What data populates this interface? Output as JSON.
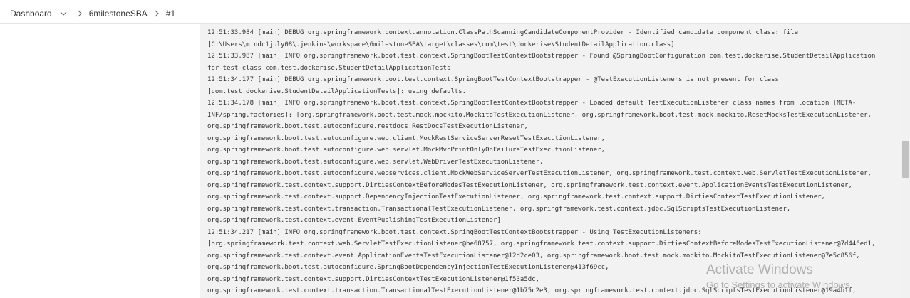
{
  "breadcrumb": {
    "dashboard": "Dashboard",
    "job": "6milestoneSBA",
    "build": "#1"
  },
  "icons": {
    "dropdown": "chevron-down-icon",
    "separator": "chevron-right-icon"
  },
  "console": {
    "lines": [
      "12:51:33.984 [main] DEBUG org.springframework.context.annotation.ClassPathScanningCandidateComponentProvider - Identified candidate component class: file",
      "[C:\\Users\\mindc1july08\\.jenkins\\workspace\\6milestoneSBA\\target\\classes\\com\\test\\dockerise\\StudentDetailApplication.class]",
      "12:51:33.987 [main] INFO org.springframework.boot.test.context.SpringBootTestContextBootstrapper - Found @SpringBootConfiguration com.test.dockerise.StudentDetailApplication",
      "for test class com.test.dockerise.StudentDetailApplicationTests",
      "12:51:34.177 [main] DEBUG org.springframework.boot.test.context.SpringBootTestContextBootstrapper - @TestExecutionListeners is not present for class",
      "[com.test.dockerise.StudentDetailApplicationTests]: using defaults.",
      "12:51:34.178 [main] INFO org.springframework.boot.test.context.SpringBootTestContextBootstrapper - Loaded default TestExecutionListener class names from location [META-",
      "INF/spring.factories]: [org.springframework.boot.test.mock.mockito.MockitoTestExecutionListener, org.springframework.boot.test.mock.mockito.ResetMocksTestExecutionListener,",
      "org.springframework.boot.test.autoconfigure.restdocs.RestDocsTestExecutionListener,",
      "org.springframework.boot.test.autoconfigure.web.client.MockRestServiceServerResetTestExecutionListener,",
      "org.springframework.boot.test.autoconfigure.web.servlet.MockMvcPrintOnlyOnFailureTestExecutionListener,",
      "org.springframework.boot.test.autoconfigure.web.servlet.WebDriverTestExecutionListener,",
      "org.springframework.boot.test.autoconfigure.webservices.client.MockWebServiceServerTestExecutionListener, org.springframework.test.context.web.ServletTestExecutionListener,",
      "org.springframework.test.context.support.DirtiesContextBeforeModesTestExecutionListener, org.springframework.test.context.event.ApplicationEventsTestExecutionListener,",
      "org.springframework.test.context.support.DependencyInjectionTestExecutionListener, org.springframework.test.context.support.DirtiesContextTestExecutionListener,",
      "org.springframework.test.context.transaction.TransactionalTestExecutionListener, org.springframework.test.context.jdbc.SqlScriptsTestExecutionListener,",
      "org.springframework.test.context.event.EventPublishingTestExecutionListener]",
      "12:51:34.217 [main] INFO org.springframework.boot.test.context.SpringBootTestContextBootstrapper - Using TestExecutionListeners:",
      "[org.springframework.test.context.web.ServletTestExecutionListener@be68757, org.springframework.test.context.support.DirtiesContextBeforeModesTestExecutionListener@7d446ed1,",
      "org.springframework.test.context.event.ApplicationEventsTestExecutionListener@12d2ce03, org.springframework.boot.test.mock.mockito.MockitoTestExecutionListener@7e5c856f,",
      "org.springframework.boot.test.autoconfigure.SpringBootDependencyInjectionTestExecutionListener@413f69cc,",
      "org.springframework.test.context.support.DirtiesContextTestExecutionListener@1f53a5dc,",
      "org.springframework.test.context.transaction.TransactionalTestExecutionListener@1b75c2e3, org.springframework.test.context.jdbc.SqlScriptsTestExecutionListener@19a4b1f,"
    ]
  },
  "watermark": {
    "title": "Activate Windows",
    "subtitle": "Go to Settings to activate Windows."
  },
  "colors": {
    "console_bg": "#f2f2f2",
    "console_text": "#333333",
    "scroll_thumb": "#c1c1c1"
  }
}
